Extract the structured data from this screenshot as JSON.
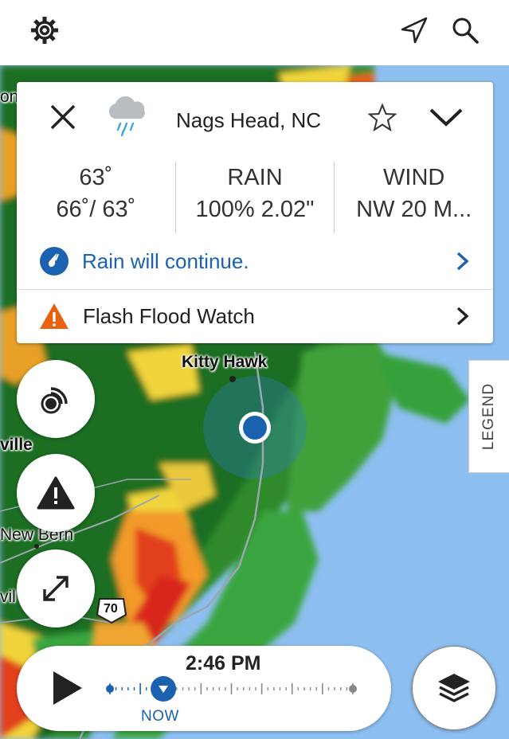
{
  "header": {
    "settings_icon": "gear-icon",
    "location_icon": "navigation-arrow-icon",
    "search_icon": "search-icon"
  },
  "card": {
    "location": "Nags Head, NC",
    "weather_icon": "rain-cloud-icon",
    "temp": {
      "current": "63˚",
      "hilo": "66˚/ 63˚"
    },
    "rain": {
      "label": "RAIN",
      "value": "100% 2.02\""
    },
    "wind": {
      "label": "WIND",
      "value": "NW 20 M..."
    },
    "nowcast": "Rain will continue.",
    "alert": "Flash Flood Watch"
  },
  "map": {
    "labels": {
      "kitty_hawk": "Kitty Hawk",
      "ville": "ville",
      "new_bern": "New Bern",
      "vil": "vil",
      "on": "on",
      "route": "70"
    }
  },
  "legend": {
    "label": "LEGEND"
  },
  "timeline": {
    "time": "2:46 PM",
    "now": "NOW",
    "progress": 0.22
  },
  "colors": {
    "accent": "#1a62b0",
    "alert": "#e8620f",
    "water": "#8dbff0"
  }
}
